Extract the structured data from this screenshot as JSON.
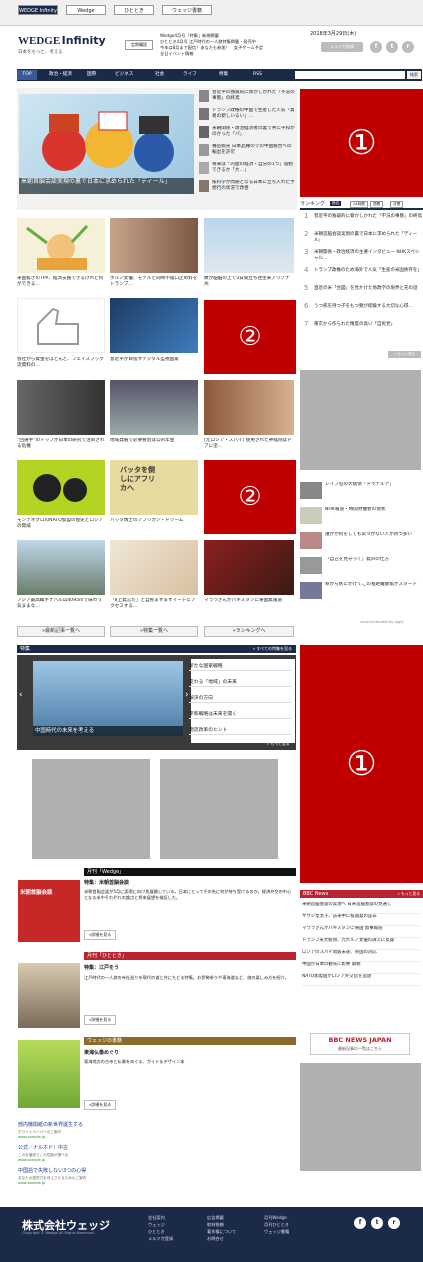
{
  "partner_tabs": [
    "WEDGE Infinity",
    "Wedge",
    "ひととき",
    "ウェッジ書籍"
  ],
  "date": "2018年3月29日(木)",
  "logo": {
    "main": "WEDGE",
    "sub": "Infinity",
    "tagline": "日本をもっと、考える"
  },
  "header_notices": [
    "Wedge4月号「特集」新規掲載",
    "ひととき4月号 江戸時代の一人旅特集掲載・発売中",
    "今年は8月まで配信！あなたも参加！　女子ゲーム予定",
    "全日イベント情報"
  ],
  "header_links": [
    "定期購読",
    "メルマガ登録"
  ],
  "nav": [
    "TOP",
    "政治・経済",
    "国際",
    "ビジネス",
    "社会",
    "ライフ",
    "特集",
    "RSS"
  ],
  "search_button": "検索",
  "hero_caption": "米朝首脳会談実現の裏で日本に求められた「ディール」",
  "hero_list": [
    "習近平の独裁的に脅かしかれた「不況の事態」の終焉",
    "トランプ政権の中国で生産した人気「貿易の新しいるい」…",
    "米朝関係・政治経済者の裏で共に平和かのかった「パ」",
    "種苗販売 日本品種のでの中国競合への輸出を許可",
    "将来は「内面の経済・自分の1つ」開始できるか「大…」",
    "核科学が問題となる日本に立ち入れた予想行の状況で改善"
  ],
  "grid_captions": [
    "米国抜きのTPP、経済支援できるけれど何ができる…",
    "ポルノ女優、モデルと同時不倫口止め料をトランプ…",
    "数が脳脳の上で3日間立ち往生来アリゾナ州",
    "会社から資金をほとんど、フェイスブック流資料の…",
    "習近平が目指すデジタル監視国家",
    "“回選手”のトップが日本の研究で注目される危機",
    "地域発展で必要要因は公的年金",
    "[元ロシア・スパイ] 使用された神経剤はドアに塗…",
    "モンテネグロのNATO加盟の歴史とロシアの脅威",
    "バッタ博士のアフリカン・ドリーム",
    "アジア最高峰キナバル山4095mで味わう気ままな…",
    "「8上発言だ」と自民ますますイートにアクセスする…",
    "マララさんがパキスタンに帰国無報道"
  ],
  "grid_book_text": "バッタを倒しにアフリカへ",
  "more_buttons": [
    "»最新記事一覧へ",
    "»特集一覧へ",
    "»ランキングへ"
  ],
  "ranking": {
    "title": "ランキング",
    "tabs": [
      "総合",
      "24時間",
      "週間",
      "月間"
    ],
    "items": [
      "習近平の独裁的に脅かしかれた「不況の事態」の終焉",
      "米朝首脳会談実現の裏で日本に求められた「ディール」",
      "米朝関係・政治経済の主要インタビュー NHKスペシャル…",
      "トランプ政権のため海外で人気「生産の米国依存を」",
      "直近の米「合図」を見かけた地政学の限界と先の話",
      "うつ病を持つ子をもつ親が経験する大切な心得…",
      "東京から作られた精度の高い「自民党」"
    ],
    "more": "» もっと見る"
  },
  "feed": {
    "items": [
      "レイプ犯の大統領「ドゥテルテ」",
      "NHK報道・時間労働者の現状",
      "誰かが何をしても気づかない人が持つ多い",
      "「自己を見守って」発声の仕方",
      "秋から秋にかけてこの長距離散策がスタート"
    ],
    "credit": "recommended by logly"
  },
  "tokushu": {
    "title": "特集",
    "all": "» すべての特集を見る",
    "caption": "中国時代の未来を考える",
    "items": [
      "新たな国家戦略",
      "変わる「地域」の未来",
      "解決の方向",
      "平和戦略は未来を開く",
      "物流改革のヒント"
    ],
    "more": "» もっと見る"
  },
  "wedge_magazine": {
    "label": "月刊「Wedge」",
    "cover_title": "米朝首脳会談",
    "title": "特集：米朝首脳会談",
    "desc": "米朝首脳会談が5月に実現に向け急展開している。日本にとってその先に何が待ち受けるのか。経済外交の中心となる米中それぞれの論点と将来展望を検証した。",
    "button": "»詳細を見る"
  },
  "hitotoki": {
    "label": "月刊「ひととき」",
    "title": "特集：江戸をう",
    "desc": "江戸時代の一人旅の寺社巡りを現代の道と共にたどる特集。お伊勢参りや東海道など、旅の楽しみ方を紹介。",
    "button": "»詳細を見る"
  },
  "books": {
    "label": "ウェッジの書籍",
    "title": "東海仏像めぐり",
    "desc": "東海地方の古寺と仏像をめぐる、ガイド＆デザイン本",
    "button": "»詳細を見る"
  },
  "bbc": {
    "label": "BBC News",
    "more": "» もっと見る",
    "items": [
      "米朝首脳会談の実現へ 日米首脳会談の見通し",
      "サウジ皇太子、訪米中に核開発の是非",
      "マララさんがパキスタンに帰国 無事報道",
      "トランプ米大統領、元ポルノ女優の訴えに反論",
      "ロシアのスパイ暗殺未遂、英国の対応",
      "中国が日本の観光に影響 関税",
      "NATO加盟国がロシア外交官を追放"
    ],
    "banner": "BBC NEWS JAPAN",
    "banner_sub": "最新記事の一覧はこちら"
  },
  "sponsored": [
    {
      "title": "部内機関紙の新世界誕生する",
      "desc": "ホワイトペーパーのご案内",
      "url": "www.sample.jp"
    },
    {
      "title": "公式／ナルホド！中古",
      "desc": "このお値段でこの性能が選べる",
      "url": "www.sample.jp"
    },
    {
      "title": "中国語で失敗しない3つの心得",
      "desc": "あなたの語学力を向上させるためのご案内",
      "url": "www.sample.jp"
    }
  ],
  "ad_labels": [
    "①",
    "②",
    "②",
    "①"
  ],
  "footer": {
    "company": "株式会社ウェッジ",
    "copyright": "Copyright © Wedge All Rights Reserved.",
    "links": [
      "会社案内",
      "ウェッジ",
      "ひととき",
      "メルマガ登録",
      "広告掲載",
      "取材依頼",
      "著作権について",
      "お問合せ",
      "月刊Wedge",
      "月刊ひととき",
      "ウェッジ書籍"
    ],
    "social": [
      "f",
      "t",
      "r"
    ]
  },
  "colors": {
    "navy": "#1c2a4a",
    "ad_red": "#c00000",
    "section_red": "#b8242f",
    "green": "#37a36f"
  }
}
